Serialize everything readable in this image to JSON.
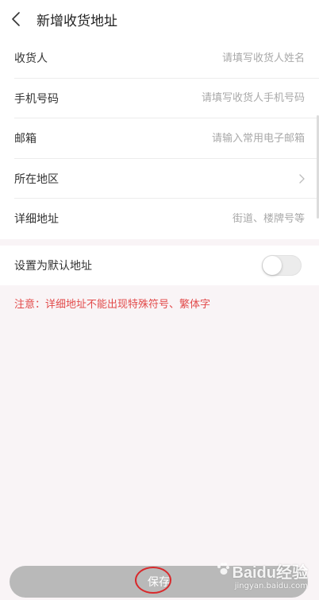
{
  "header": {
    "title": "新增收货地址"
  },
  "form": {
    "rows": [
      {
        "label": "收货人",
        "placeholder": "请填写收货人姓名"
      },
      {
        "label": "手机号码",
        "placeholder": "请填写收货人手机号码"
      },
      {
        "label": "邮箱",
        "placeholder": "请输入常用电子邮箱"
      },
      {
        "label": "所在地区",
        "placeholder": ""
      },
      {
        "label": "详细地址",
        "placeholder": "街道、楼牌号等"
      }
    ]
  },
  "default_address": {
    "label": "设置为默认地址",
    "enabled": false
  },
  "notice": "注意：详细地址不能出现特殊符号、繁体字",
  "save_button": {
    "label": "保存"
  },
  "watermark": {
    "logo_text": "Baidu经验",
    "site": "jingyan.baidu.com"
  },
  "colors": {
    "notice": "#e24a4a",
    "save_bar": "#b9b9b9",
    "highlight_ring": "#d8282b",
    "background": "#f9f4f6"
  }
}
